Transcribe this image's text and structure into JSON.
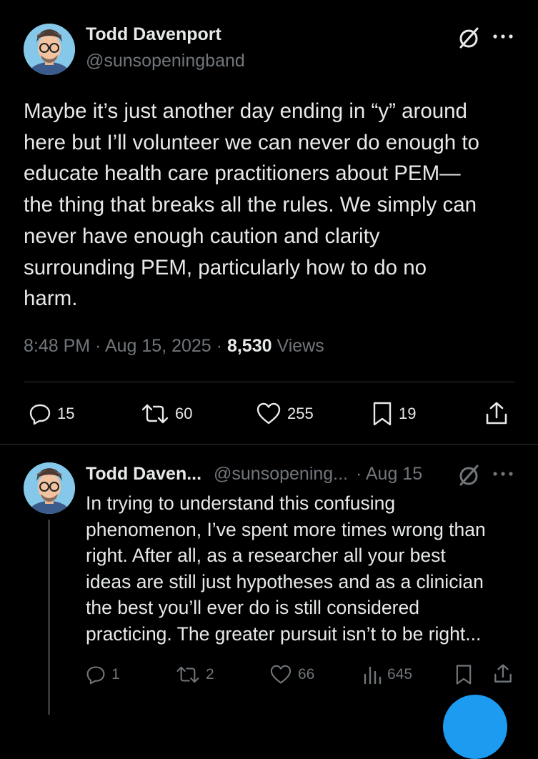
{
  "main_post": {
    "author_name": "Todd Davenport",
    "author_handle": "@sunsopeningband",
    "text_lines": [
      "Maybe it’s just another day ending in “y” around",
      "here but I’ll volunteer we can never do enough to",
      "educate health care practitioners about PEM—",
      "the thing that breaks all the rules. We simply can",
      "never have enough caution and clarity",
      "surrounding PEM, particularly how to do no",
      "harm."
    ],
    "time": "8:48 PM",
    "date": "Aug 15, 2025",
    "separator": "·",
    "views_count": "8,530",
    "views_label": "Views",
    "replies": "15",
    "reposts": "60",
    "likes": "255",
    "bookmarks": "19"
  },
  "reply_post": {
    "author_name": "Todd Daven...",
    "author_handle": "@sunsopening...",
    "date": "· Aug 15",
    "text_lines": [
      "In trying to understand this confusing",
      "phenomenon, I’ve spent more times wrong than",
      "right. After all, as a researcher all your best",
      "ideas are still just hypotheses and as a clinician",
      "the best you’ll ever do is still considered",
      "practicing. The greater pursuit isn’t to be right..."
    ],
    "replies": "1",
    "reposts": "2",
    "likes": "66",
    "views": "645"
  },
  "icons": {
    "grok": "grok-icon",
    "more": "more-icon",
    "reply": "reply-icon",
    "repost": "repost-icon",
    "like": "like-icon",
    "bookmark": "bookmark-icon",
    "share": "share-icon",
    "views": "views-icon",
    "compose": "compose-fab-icon"
  },
  "colors": {
    "background": "#000000",
    "text": "#e7e9ea",
    "muted": "#71767b",
    "divider": "#2f3336",
    "accent": "#1d9bf0"
  }
}
